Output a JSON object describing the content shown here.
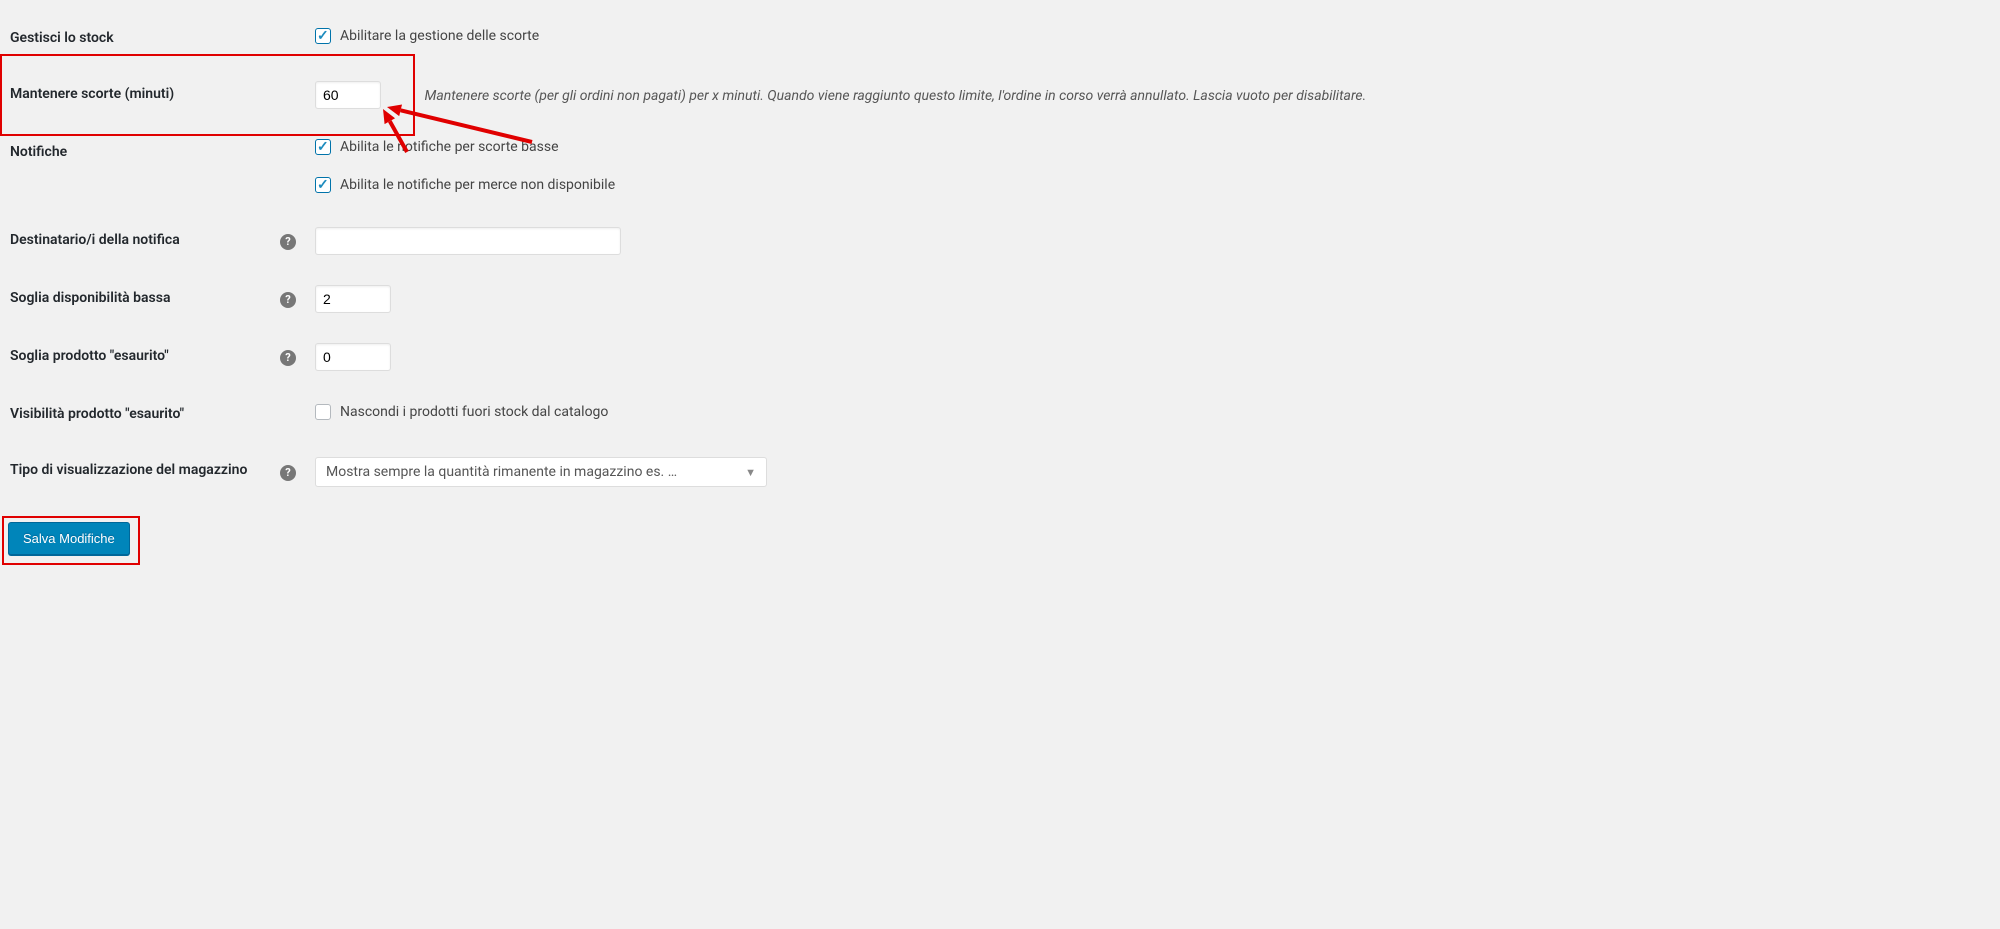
{
  "rows": {
    "manage_stock": {
      "label": "Gestisci lo stock",
      "checkbox_label": "Abilitare la gestione delle scorte",
      "checked": true
    },
    "hold_stock": {
      "label": "Mantenere scorte (minuti)",
      "value": "60",
      "description": "Mantenere scorte (per gli ordini non pagati) per x minuti. Quando viene raggiunto questo limite, l'ordine in corso verrà annullato. Lascia vuoto per disabilitare."
    },
    "notifications": {
      "label": "Notifiche",
      "low_stock_label": "Abilita le notifiche per scorte basse",
      "low_stock_checked": true,
      "out_of_stock_label": "Abilita le notifiche per merce non disponibile",
      "out_of_stock_checked": true
    },
    "recipient": {
      "label": "Destinatario/i della notifica",
      "value": ""
    },
    "low_threshold": {
      "label": "Soglia disponibilità bassa",
      "value": "2"
    },
    "out_threshold": {
      "label": "Soglia prodotto \"esaurito\"",
      "value": "0"
    },
    "out_visibility": {
      "label": "Visibilità prodotto \"esaurito\"",
      "checkbox_label": "Nascondi i prodotti fuori stock dal catalogo",
      "checked": false
    },
    "stock_display": {
      "label": "Tipo di visualizzazione del magazzino",
      "selected": "Mostra sempre la quantità rimanente in magazzino es. …"
    }
  },
  "save_button": "Salva Modifiche",
  "annotations": {
    "hold_stock_highlight_color": "#e00000"
  }
}
